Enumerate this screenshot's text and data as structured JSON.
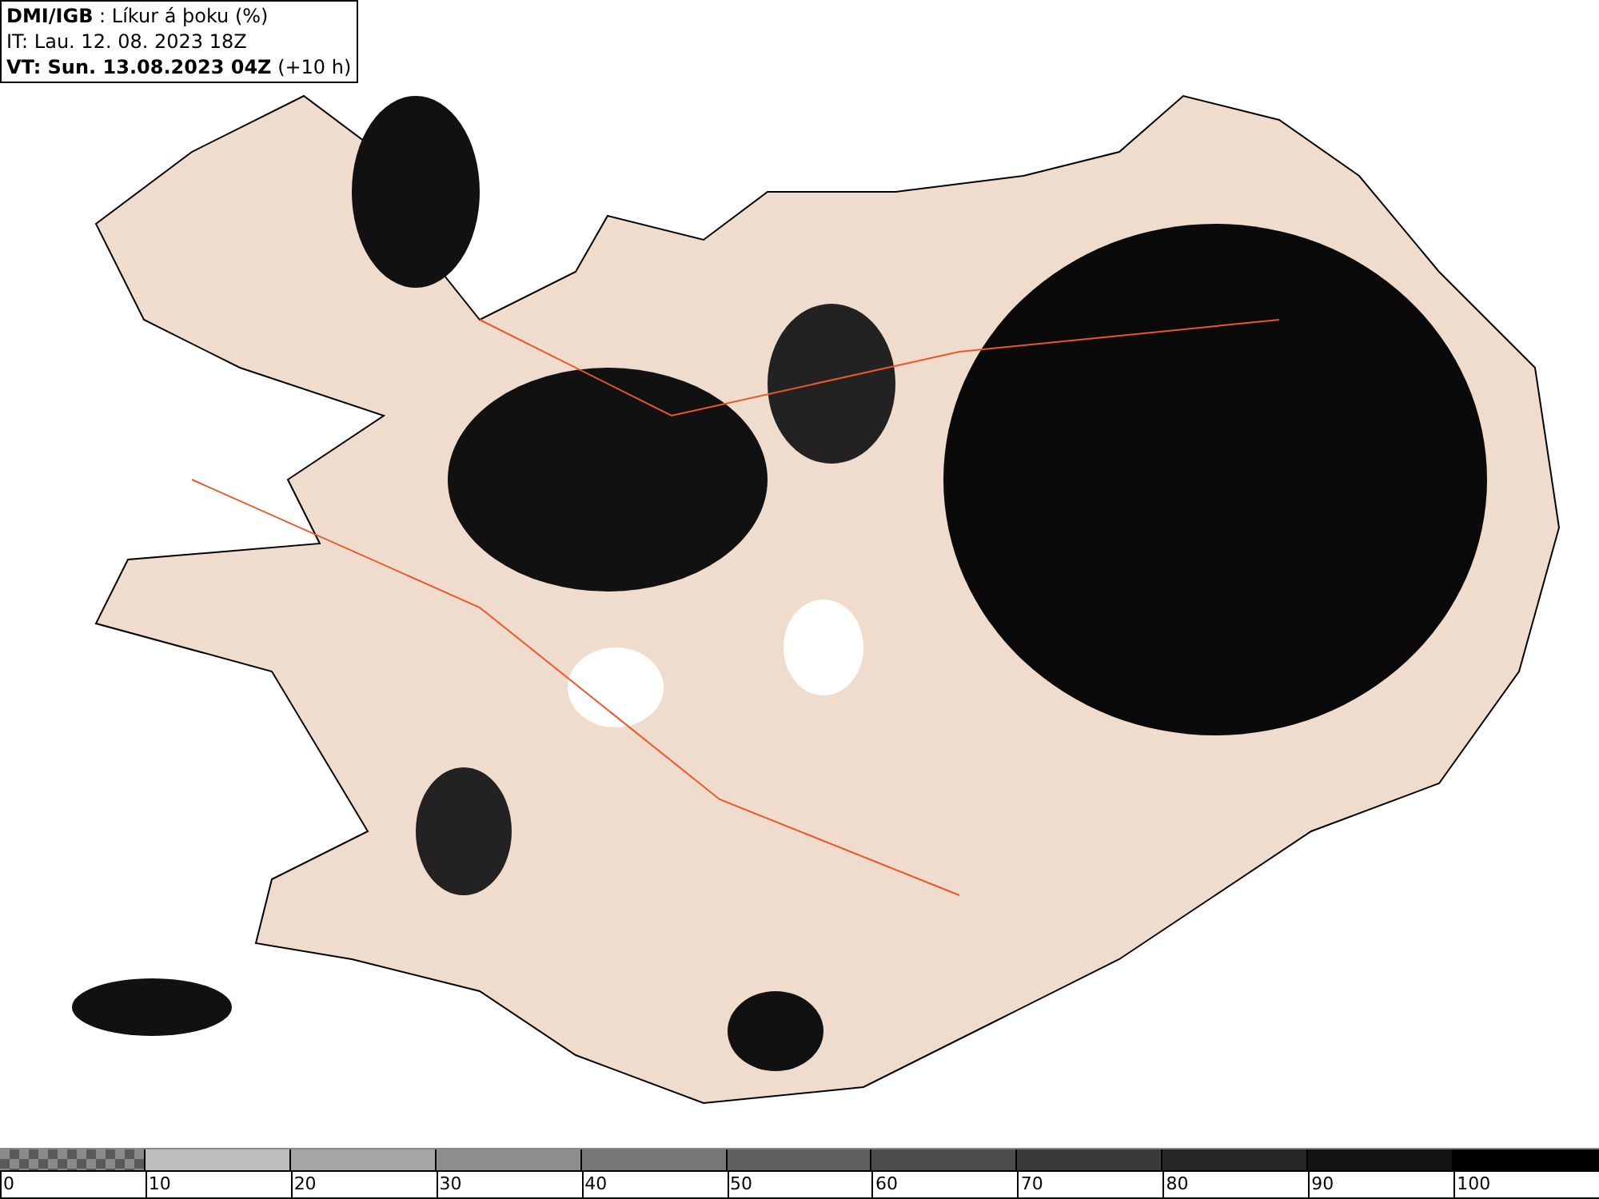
{
  "header": {
    "title": "**DMI/IGB** : Líkur á þoku (%)",
    "issue_time": "IT: Lau. 12. 08. 2023 18Z",
    "valid_time": "**VT: Sun. 13.08.2023 04Z** (+10 h)"
  },
  "legend": {
    "segments": [
      {
        "kind": "checker",
        "color": "#5a5a5a"
      },
      {
        "kind": "solid",
        "color": "#bdbdbd"
      },
      {
        "kind": "solid",
        "color": "#a6a6a6"
      },
      {
        "kind": "solid",
        "color": "#8e8e8e"
      },
      {
        "kind": "solid",
        "color": "#777777"
      },
      {
        "kind": "solid",
        "color": "#606060"
      },
      {
        "kind": "solid",
        "color": "#4d4d4d"
      },
      {
        "kind": "solid",
        "color": "#3a3a3a"
      },
      {
        "kind": "solid",
        "color": "#262626"
      },
      {
        "kind": "solid",
        "color": "#141414"
      },
      {
        "kind": "solid",
        "color": "#000000"
      }
    ],
    "labels": [
      "0",
      "10",
      "20",
      "30",
      "40",
      "50",
      "60",
      "70",
      "80",
      "90",
      "100"
    ]
  }
}
